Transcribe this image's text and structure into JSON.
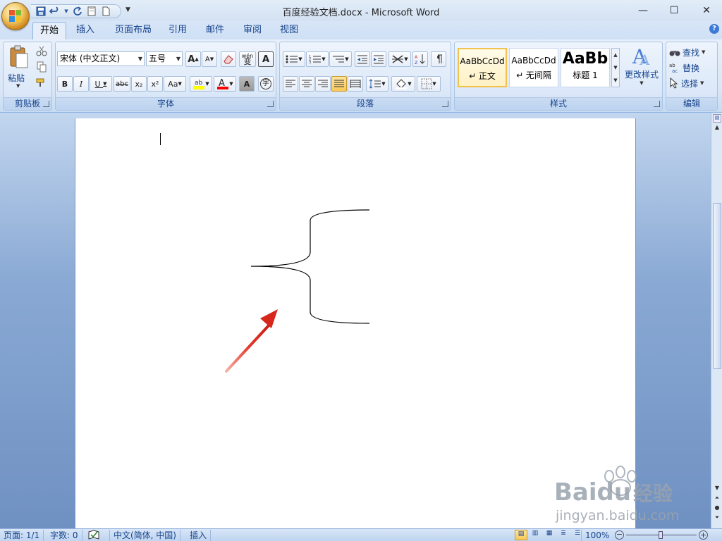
{
  "window": {
    "title": "百度经验文档.docx - Microsoft Word",
    "minimize_glyph": "—",
    "maximize_glyph": "☐",
    "close_glyph": "✕"
  },
  "tabs": [
    {
      "label": "开始"
    },
    {
      "label": "插入"
    },
    {
      "label": "页面布局"
    },
    {
      "label": "引用"
    },
    {
      "label": "邮件"
    },
    {
      "label": "审阅"
    },
    {
      "label": "视图"
    }
  ],
  "help_glyph": "?",
  "ribbon": {
    "clipboard": {
      "paste_label": "粘贴",
      "group_label": "剪贴板"
    },
    "font": {
      "font_name": "宋体 (中文正文)",
      "font_size": "五号",
      "bold": "B",
      "italic": "I",
      "underline": "U",
      "strike": "abc",
      "subscript": "x₂",
      "superscript": "x²",
      "change_case": "Aa",
      "grow": "A",
      "shrink": "A",
      "char_shade": "A",
      "enclose": "字",
      "phonetic": "wén",
      "group_label": "字体"
    },
    "paragraph": {
      "group_label": "段落"
    },
    "styles": {
      "items": [
        {
          "preview": "AaBbCcDd",
          "name": "↵ 正文"
        },
        {
          "preview": "AaBbCcDd",
          "name": "↵ 无间隔"
        },
        {
          "preview": "AaBb",
          "name": "标题 1"
        }
      ],
      "change_styles": "更改样式",
      "group_label": "样式"
    },
    "editing": {
      "find": "查找",
      "replace": "替换",
      "select": "选择",
      "group_label": "编辑"
    }
  },
  "status": {
    "page": "页面: 1/1",
    "words": "字数: 0",
    "language": "中文(简体, 中国)",
    "mode": "插入",
    "zoom": "100%"
  },
  "watermark": {
    "brand": "Baidu",
    "brand_cn": "经验",
    "url": "jingyan.baidu.com"
  },
  "colors": {
    "arrow": "#e02020",
    "highlight": "#ffff00",
    "font_color": "#ff0000",
    "accent": "#15428b"
  }
}
